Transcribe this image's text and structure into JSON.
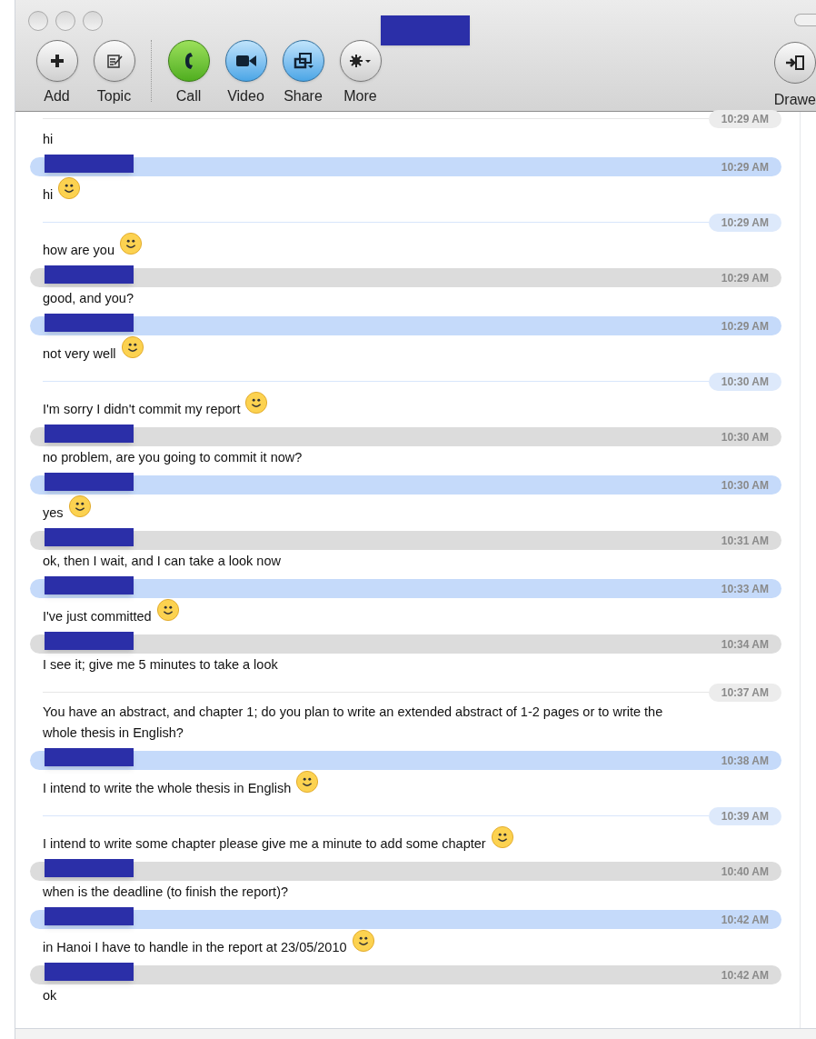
{
  "toolbar": {
    "buttons": [
      {
        "label": "Add",
        "kind": "add"
      },
      {
        "label": "Topic",
        "kind": "topic"
      },
      {
        "label": "Call",
        "kind": "call"
      },
      {
        "label": "Video",
        "kind": "video"
      },
      {
        "label": "Share",
        "kind": "share"
      },
      {
        "label": "More",
        "kind": "more"
      }
    ],
    "drawer": {
      "label": "Drawe"
    }
  },
  "messages": [
    {
      "kind": "them_cont",
      "time": "10:29 AM",
      "text": "hi",
      "smiley": false
    },
    {
      "kind": "me",
      "time": "10:29 AM",
      "text": "hi",
      "smiley": true
    },
    {
      "kind": "me_cont",
      "time": "10:29 AM",
      "text": "how are you",
      "smiley": true
    },
    {
      "kind": "them",
      "time": "10:29 AM",
      "text": "good, and you?",
      "smiley": false
    },
    {
      "kind": "me",
      "time": "10:29 AM",
      "text": "not very well",
      "smiley": true
    },
    {
      "kind": "me_cont",
      "time": "10:30 AM",
      "text": "I'm sorry I didn't commit my report",
      "smiley": true
    },
    {
      "kind": "them",
      "time": "10:30 AM",
      "text": "no problem, are you going to commit it now?",
      "smiley": false
    },
    {
      "kind": "me",
      "time": "10:30 AM",
      "text": "yes",
      "smiley": true
    },
    {
      "kind": "them",
      "time": "10:31 AM",
      "text": "ok, then I wait, and I can take a look now",
      "smiley": false
    },
    {
      "kind": "me",
      "time": "10:33 AM",
      "text": "I've just committed",
      "smiley": true
    },
    {
      "kind": "them",
      "time": "10:34 AM",
      "text": "I see it; give me 5 minutes to take a look",
      "smiley": false
    },
    {
      "kind": "them_cont",
      "time": "10:37 AM",
      "text": "You have an abstract, and chapter 1; do you plan to write an extended abstract of 1-2 pages or to write the whole thesis in English?",
      "smiley": false
    },
    {
      "kind": "me",
      "time": "10:38 AM",
      "text": "I intend to write the whole thesis in English",
      "smiley": true
    },
    {
      "kind": "me_cont",
      "time": "10:39 AM",
      "text": "I intend to write some chapter please give me a minute to add some chapter",
      "smiley": true
    },
    {
      "kind": "them",
      "time": "10:40 AM",
      "text": "when is the deadline (to finish the report)?",
      "smiley": false
    },
    {
      "kind": "me",
      "time": "10:42 AM",
      "text": "in Hanoi I have to handle in the report at 23/05/2010",
      "smiley": true
    },
    {
      "kind": "them",
      "time": "10:42 AM",
      "text": "ok",
      "smiley": false
    }
  ]
}
